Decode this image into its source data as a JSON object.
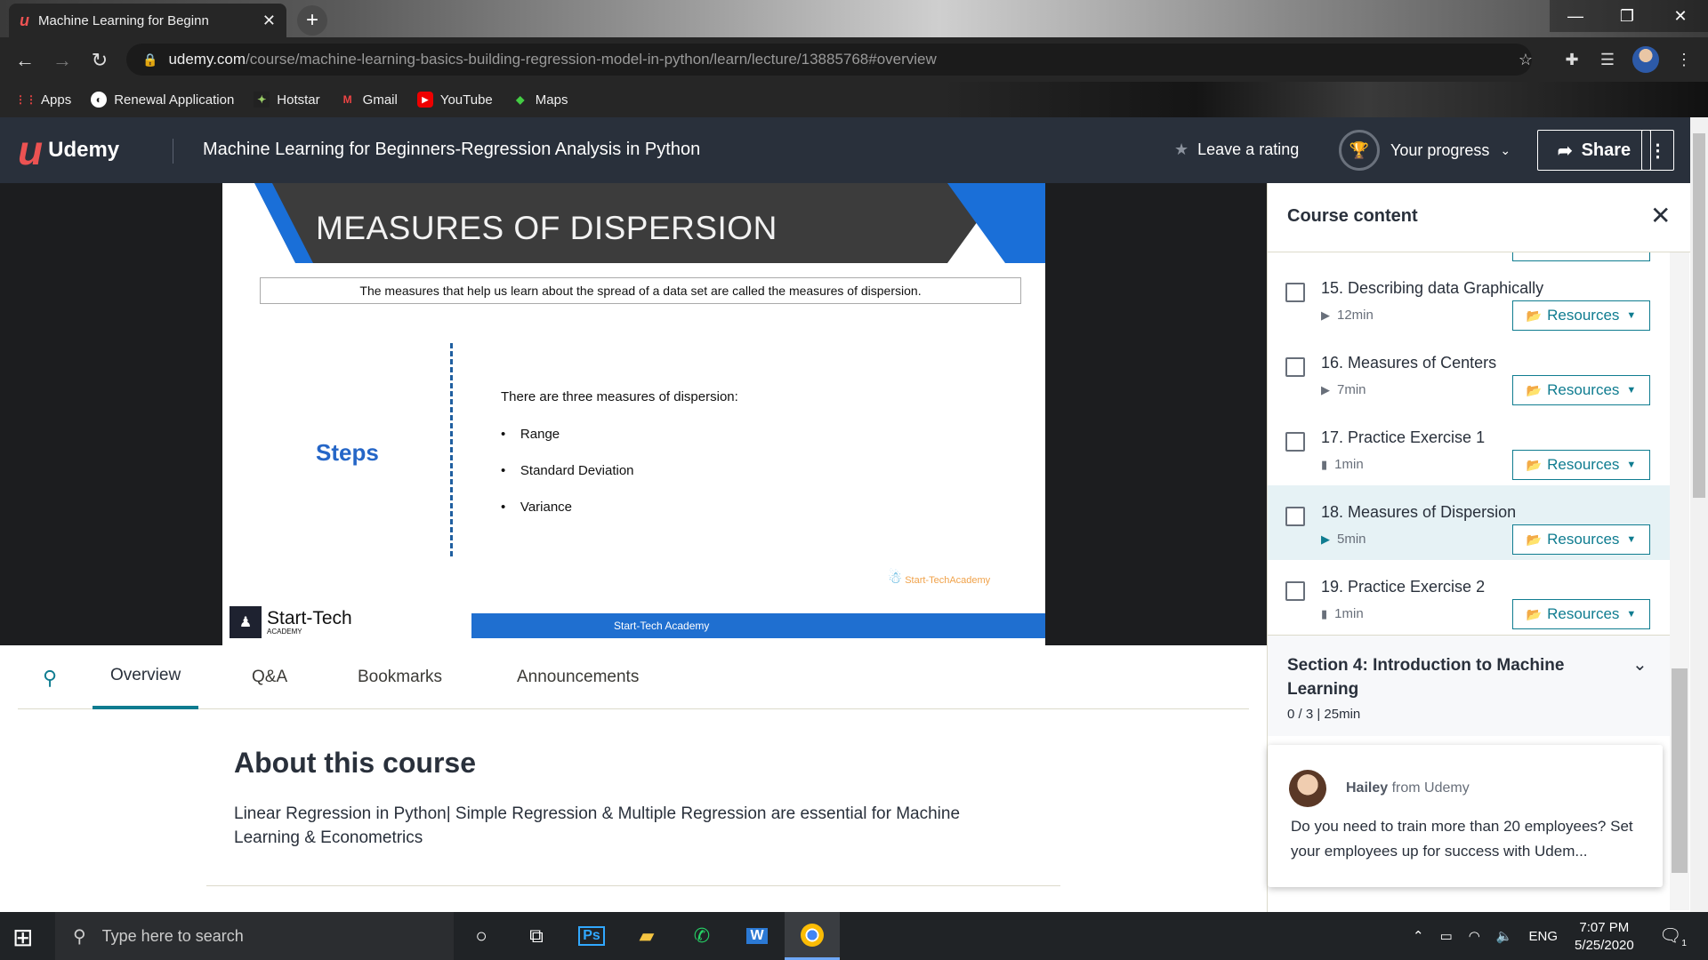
{
  "browser": {
    "tab_title": "Machine Learning for Beginn",
    "tab_close": "✕",
    "new_tab": "+",
    "url_host": "udemy.com",
    "url_path": "/course/machine-learning-basics-building-regression-model-in-python/learn/lecture/13885768#overview",
    "bookmarks": [
      {
        "label": "Apps",
        "icon": "apps-grid-icon"
      },
      {
        "label": "Renewal Application",
        "icon": "globe-icon"
      },
      {
        "label": "Hotstar",
        "icon": "hotstar-icon"
      },
      {
        "label": "Gmail",
        "icon": "gmail-icon"
      },
      {
        "label": "YouTube",
        "icon": "youtube-icon"
      },
      {
        "label": "Maps",
        "icon": "maps-icon"
      }
    ]
  },
  "header": {
    "brand": "Udemy",
    "course_title": "Machine Learning for Beginners-Regression Analysis in Python",
    "leave_rating": "Leave a rating",
    "your_progress": "Your progress",
    "share": "Share"
  },
  "slide": {
    "title": "MEASURES OF DISPERSION",
    "definition": "The measures that help us learn about the spread of a data set are called the measures of dispersion.",
    "steps_label": "Steps",
    "intro": "There are three measures of dispersion:",
    "bullets": [
      "Range",
      "Standard Deviation",
      "Variance"
    ],
    "watermark": "Start-TechAcademy",
    "logo_name": "Start-Tech",
    "logo_sub": "ACADEMY",
    "footer": "Start-Tech Academy"
  },
  "content_tabs": [
    "Overview",
    "Q&A",
    "Bookmarks",
    "Announcements"
  ],
  "about": {
    "heading": "About this course",
    "description": "Linear Regression in Python| Simple Regression & Multiple Regression are essential for Machine Learning & Econometrics"
  },
  "sidebar": {
    "title": "Course content",
    "resources_label": "Resources",
    "lectures": [
      {
        "title": "15. Describing data Graphically",
        "duration": "12min",
        "type": "video",
        "active": false
      },
      {
        "title": "16. Measures of Centers",
        "duration": "7min",
        "type": "video",
        "active": false
      },
      {
        "title": "17. Practice Exercise 1",
        "duration": "1min",
        "type": "file",
        "active": false
      },
      {
        "title": "18. Measures of Dispersion",
        "duration": "5min",
        "type": "video",
        "active": true
      },
      {
        "title": "19. Practice Exercise 2",
        "duration": "1min",
        "type": "file",
        "active": false
      }
    ],
    "section4": {
      "title": "Section 4: Introduction to Machine Learning",
      "meta": "0 / 3 | 25min"
    },
    "chat": {
      "name": "Hailey",
      "from": "from Udemy",
      "message": "Do you need to train more than 20 employees? Set your employees up for success with Udem..."
    }
  },
  "taskbar": {
    "search_placeholder": "Type here to search",
    "lang": "ENG",
    "time": "7:07 PM",
    "date": "5/25/2020",
    "notif_count": "1"
  },
  "colors": {
    "udemy_red": "#ec5252",
    "teal": "#0f7c90",
    "header_bg": "#29303b",
    "slide_blue": "#1f6fd0"
  }
}
